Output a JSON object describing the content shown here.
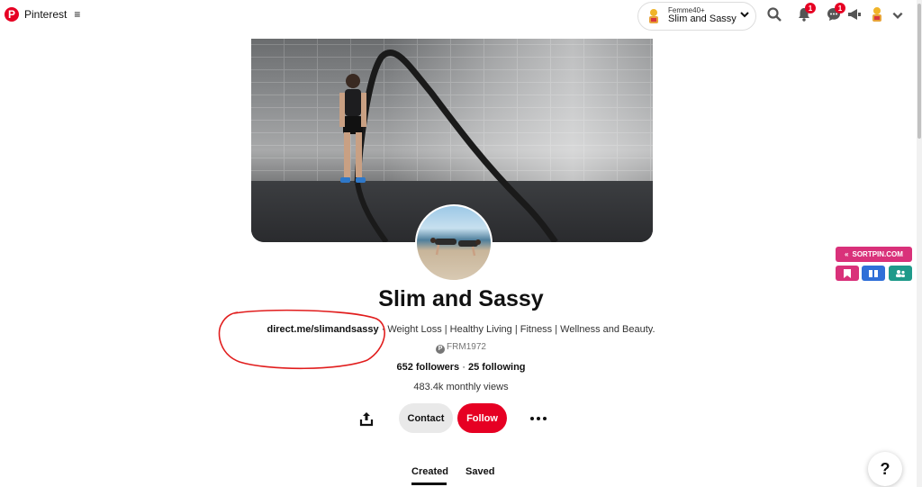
{
  "header": {
    "brand": "Pinterest",
    "account_switcher": {
      "label_small": "Femme40+",
      "label": "Slim and Sassy"
    },
    "notifications_count": "1",
    "messages_count": "1"
  },
  "profile": {
    "name": "Slim and Sassy",
    "bio_link": "direct.me/slimandsassy",
    "bio_text": " · Weight Loss | Healthy Living | Fitness | Wellness and Beauty.",
    "handle": "FRM1972",
    "followers": "652 followers",
    "following": "25 following",
    "monthly_views": "483.4k monthly views"
  },
  "actions": {
    "contact": "Contact",
    "follow": "Follow"
  },
  "tabs": [
    {
      "label": "Created",
      "active": true
    },
    {
      "label": "Saved",
      "active": false
    }
  ],
  "sortpin": {
    "label": "SORTPIN.COM",
    "colors": {
      "main": "#d9317a",
      "blue": "#2f6fd8",
      "teal": "#1f9a8a"
    }
  },
  "help": "?",
  "colors": {
    "accent": "#e60023",
    "annotation": "#e11d1d"
  }
}
